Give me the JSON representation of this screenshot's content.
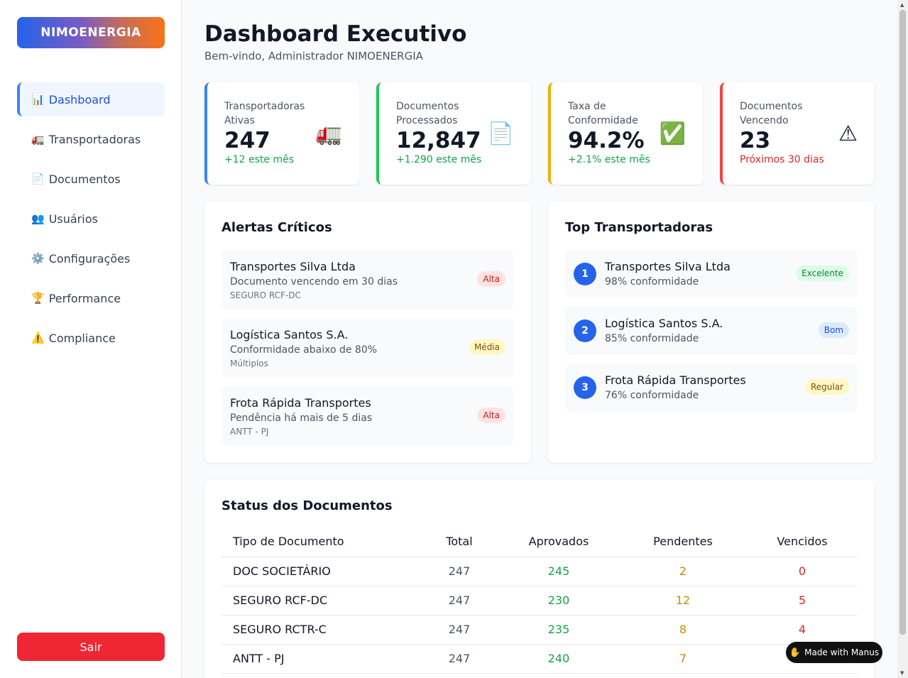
{
  "sidebar": {
    "logo": "NIMOENERGIA",
    "items": [
      {
        "icon": "📊",
        "label": "Dashboard"
      },
      {
        "icon": "🚛",
        "label": "Transportadoras"
      },
      {
        "icon": "📄",
        "label": "Documentos"
      },
      {
        "icon": "👥",
        "label": "Usuários"
      },
      {
        "icon": "⚙️",
        "label": "Configurações"
      },
      {
        "icon": "🏆",
        "label": "Performance"
      },
      {
        "icon": "⚠️",
        "label": "Compliance"
      }
    ],
    "logout": "Sair"
  },
  "header": {
    "title": "Dashboard Executivo",
    "subtitle": "Bem-vindo, Administrador NIMOENERGIA"
  },
  "stats": [
    {
      "label": "Transportadoras Ativas",
      "value": "247",
      "change": "+12 este mês",
      "icon": "🚛",
      "color": "#3b82f6",
      "change_color": "#16a34a"
    },
    {
      "label": "Documentos Processados",
      "value": "12,847",
      "change": "+1.290 este mês",
      "icon": "📄",
      "color": "#22c55e",
      "change_color": "#16a34a"
    },
    {
      "label": "Taxa de Conformidade",
      "value": "94.2%",
      "change": "+2.1% este mês",
      "icon": "✅",
      "color": "#eab308",
      "change_color": "#16a34a"
    },
    {
      "label": "Documentos Vencendo",
      "value": "23",
      "change": "Próximos 30 dias",
      "icon": "⚠",
      "color": "#ef4444",
      "change_color": "#dc2626"
    }
  ],
  "alerts": {
    "title": "Alertas Críticos",
    "items": [
      {
        "name": "Transportes Silva Ltda",
        "desc": "Documento vencendo em 30 dias",
        "doc": "SEGURO RCF-DC",
        "priority": "Alta"
      },
      {
        "name": "Logística Santos S.A.",
        "desc": "Conformidade abaixo de 80%",
        "doc": "Múltiplos",
        "priority": "Média"
      },
      {
        "name": "Frota Rápida Transportes",
        "desc": "Pendência há mais de 5 dias",
        "doc": "ANTT - PJ",
        "priority": "Alta"
      }
    ]
  },
  "top": {
    "title": "Top Transportadoras",
    "items": [
      {
        "rank": "1",
        "name": "Transportes Silva Ltda",
        "conf": "98% conformidade",
        "rating": "Excelente"
      },
      {
        "rank": "2",
        "name": "Logística Santos S.A.",
        "conf": "85% conformidade",
        "rating": "Bom"
      },
      {
        "rank": "3",
        "name": "Frota Rápida Transportes",
        "conf": "76% conformidade",
        "rating": "Regular"
      }
    ]
  },
  "status": {
    "title": "Status dos Documentos",
    "columns": [
      "Tipo de Documento",
      "Total",
      "Aprovados",
      "Pendentes",
      "Vencidos"
    ],
    "rows": [
      [
        "DOC SOCIETÁRIO",
        "247",
        "245",
        "2",
        "0"
      ],
      [
        "SEGURO RCF-DC",
        "247",
        "230",
        "12",
        "5"
      ],
      [
        "SEGURO RCTR-C",
        "247",
        "235",
        "8",
        "4"
      ],
      [
        "ANTT - PJ",
        "247",
        "240",
        "7",
        ""
      ]
    ]
  },
  "badge": {
    "icon": "✋",
    "label": "Made with Manus"
  }
}
